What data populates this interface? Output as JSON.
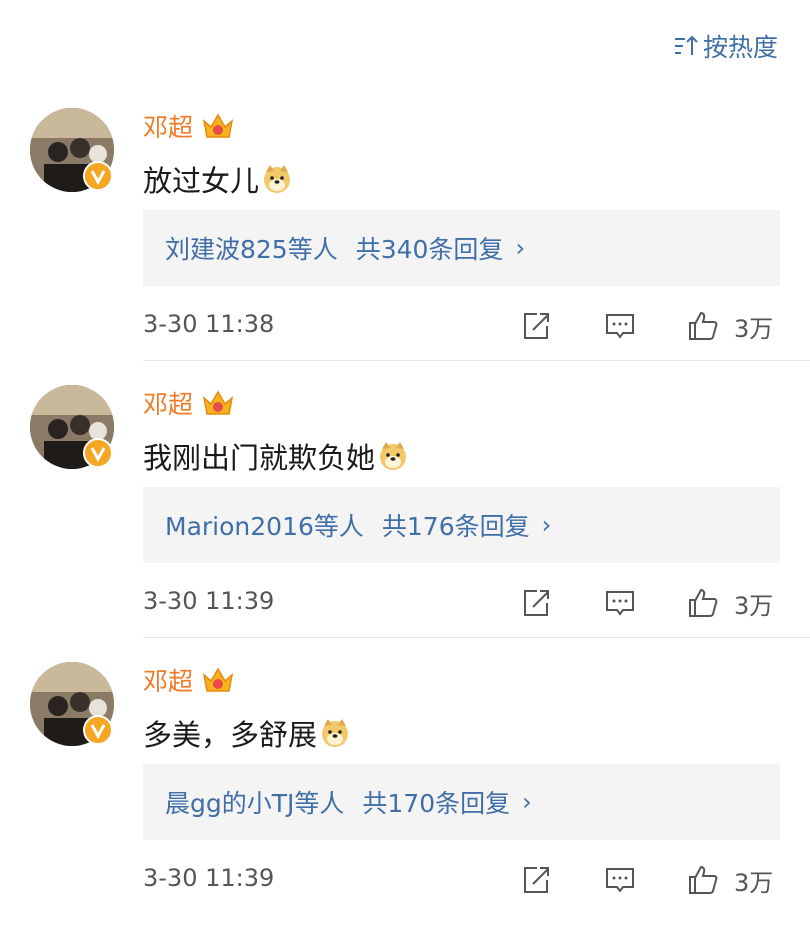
{
  "sort": {
    "label": "按热度",
    "icon": "sort-icon"
  },
  "comments": [
    {
      "author": "邓超",
      "text": "放过女儿",
      "reply_users": "刘建波825等人",
      "reply_total": "共340条回复",
      "time": "3-30 11:38",
      "likes": "3万"
    },
    {
      "author": "邓超",
      "text": "我刚出门就欺负她",
      "reply_users": "Marion2016等人",
      "reply_total": "共176条回复",
      "time": "3-30 11:39",
      "likes": "3万"
    },
    {
      "author": "邓超",
      "text": "多美，多舒展",
      "reply_users": "晨gg的小TJ等人",
      "reply_total": "共170条回复",
      "time": "3-30 11:39",
      "likes": "3万"
    }
  ],
  "colors": {
    "name": "#f07b27",
    "link": "#3f6fa6",
    "reply_bg": "#f4f4f4",
    "verified": "#f5a623"
  }
}
